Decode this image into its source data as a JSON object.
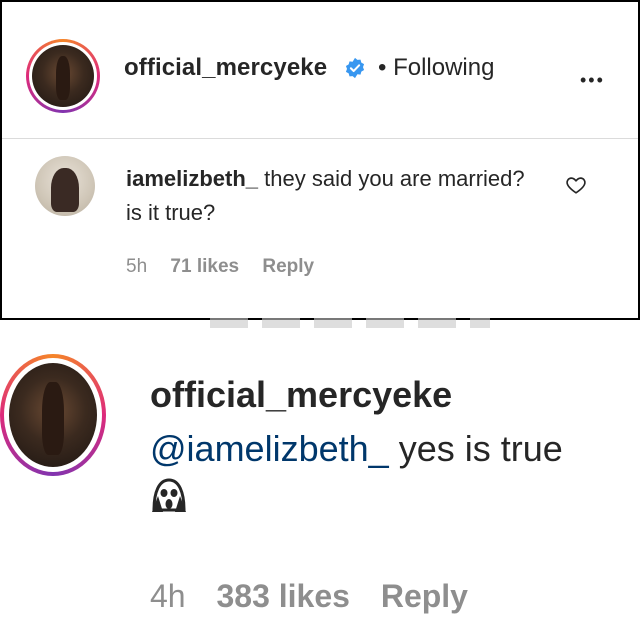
{
  "post_header": {
    "username": "official_mercyeke",
    "follow_status": "• Following",
    "more_icon": "more-dots-icon",
    "verified_icon": "verified-badge-icon",
    "verified_color": "#3897f0"
  },
  "comment_1": {
    "username": "iamelizbeth_",
    "text": "they said you are married? is it true?",
    "time": "5h",
    "likes": "71 likes",
    "reply": "Reply",
    "like_icon": "heart-icon"
  },
  "comment_2": {
    "username": "official_mercyeke",
    "mention": "@iamelizbeth_",
    "text": "yes is true",
    "emoji": "screaming-face-emoji",
    "time": "4h",
    "likes": "383 likes",
    "reply": "Reply"
  },
  "colors": {
    "text": "#262626",
    "muted": "#8e8e8e",
    "mention": "#00376b",
    "story_ring": "#dd2a7b"
  }
}
